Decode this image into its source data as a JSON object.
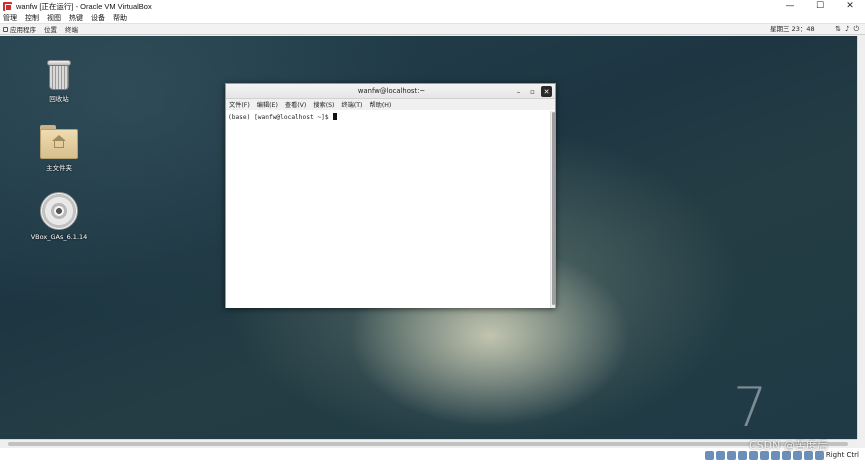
{
  "host": {
    "title": "wanfw [正在运行] - Oracle VM VirtualBox",
    "window_buttons": {
      "minimize": "—",
      "maximize": "☐",
      "close": "✕"
    },
    "menu": [
      "管理",
      "控制",
      "视图",
      "热键",
      "设备",
      "帮助"
    ],
    "host_key": "Right Ctrl"
  },
  "guest_topbar": {
    "apps": "应用程序",
    "places": "位置",
    "terminal": "终端",
    "clock": "星期三 23：48",
    "tray_icons": [
      "network-icon",
      "volume-icon",
      "power-icon"
    ]
  },
  "desktop": {
    "icons": [
      {
        "label": "回收站",
        "icon": "trash-icon"
      },
      {
        "label": "主文件夹",
        "icon": "home-folder-icon"
      },
      {
        "label": "VBox_GAs_6.1.14",
        "icon": "disc-icon"
      }
    ],
    "wallpaper_digit": "7"
  },
  "terminal": {
    "title": "wanfw@localhost:~",
    "menu": [
      "文件(F)",
      "编辑(E)",
      "查看(V)",
      "搜索(S)",
      "终端(T)",
      "帮助(H)"
    ],
    "prompt": "(base) [wanfw@localhost ~]$ "
  },
  "watermark": "CSDN @苦度后"
}
